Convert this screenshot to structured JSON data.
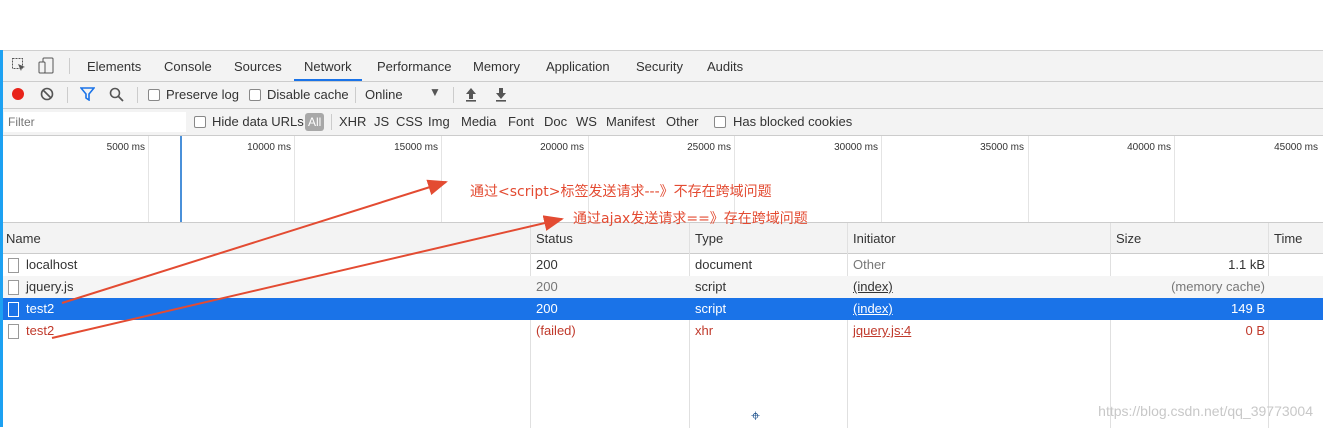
{
  "devtools": {
    "tabs": [
      "Elements",
      "Console",
      "Sources",
      "Network",
      "Performance",
      "Memory",
      "Application",
      "Security",
      "Audits"
    ],
    "active_tab": "Network"
  },
  "toolbar": {
    "preserve_log": "Preserve log",
    "disable_cache": "Disable cache",
    "throttle": "Online"
  },
  "filterbar": {
    "placeholder": "Filter",
    "hide_data_urls": "Hide data URLs",
    "types": [
      "All",
      "XHR",
      "JS",
      "CSS",
      "Img",
      "Media",
      "Font",
      "Doc",
      "WS",
      "Manifest",
      "Other"
    ],
    "has_blocked_cookies": "Has blocked cookies"
  },
  "overview": {
    "ticks": [
      "5000 ms",
      "10000 ms",
      "15000 ms",
      "20000 ms",
      "25000 ms",
      "30000 ms",
      "35000 ms",
      "40000 ms",
      "45000 ms"
    ]
  },
  "table": {
    "columns": {
      "name": "Name",
      "status": "Status",
      "type": "Type",
      "initiator": "Initiator",
      "size": "Size",
      "time": "Time"
    },
    "rows": [
      {
        "name": "localhost",
        "status": "200",
        "type": "document",
        "initiator": "Other",
        "size": "1.1 kB"
      },
      {
        "name": "jquery.js",
        "status": "200",
        "type": "script",
        "initiator": "(index)",
        "size": "(memory cache)"
      },
      {
        "name": "test2",
        "status": "200",
        "type": "script",
        "initiator": "(index)",
        "size": "149 B"
      },
      {
        "name": "test2",
        "status": "(failed)",
        "type": "xhr",
        "initiator": "jquery.js:4",
        "size": "0 B"
      }
    ]
  },
  "annotations": {
    "line1": "通过<script>标签发送请求---》不存在跨域问题",
    "line2": "通过ajax发送请求==》存在跨域问题",
    "color": "#e34b32"
  },
  "watermark": "https://blog.csdn.net/qq_39773004"
}
